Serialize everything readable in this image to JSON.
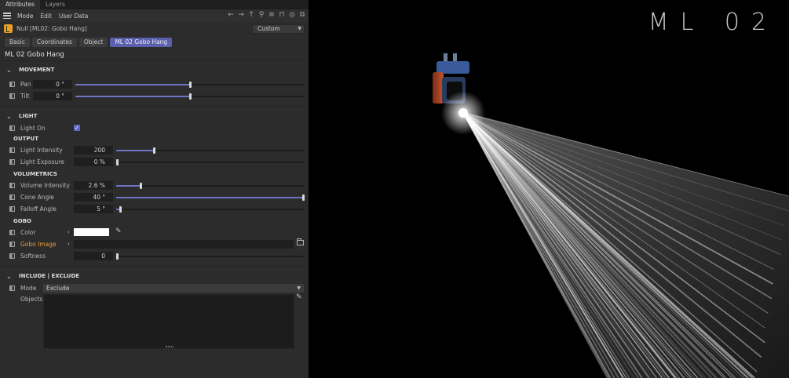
{
  "tabs": [
    "Attributes",
    "Layers"
  ],
  "menu": [
    "Mode",
    "Edit",
    "User Data"
  ],
  "toolbar_icons": [
    "back-icon",
    "forward-icon",
    "up-icon",
    "search-icon",
    "filter-icon",
    "lock-icon",
    "target-icon",
    "new-window-icon"
  ],
  "object": {
    "name": "Null [ML02: Gobo Hang]",
    "icon": "null-object-icon",
    "preset": "Custom"
  },
  "page_tabs": [
    {
      "label": "Basic",
      "active": false
    },
    {
      "label": "Coordinates",
      "active": false
    },
    {
      "label": "Object",
      "active": false
    },
    {
      "label": "ML 02 Gobo Hang",
      "active": true
    }
  ],
  "panel_title": "ML 02 Gobo Hang",
  "movement": {
    "header": "MOVEMENT",
    "pan": {
      "label": "Pan",
      "value": "0 °",
      "level": 0.5
    },
    "tilt": {
      "label": "Tilt",
      "value": "0 °",
      "level": 0.5
    }
  },
  "light": {
    "header": "LIGHT",
    "light_on": {
      "label": "Light On",
      "checked": true
    },
    "output_header": "OUTPUT",
    "intensity": {
      "label": "Light Intensity",
      "value": "200",
      "level": 0.2
    },
    "exposure": {
      "label": "Light Exposure",
      "value": "0 %",
      "level": 0.0
    },
    "volumetrics_header": "VOLUMETRICS",
    "volume_intensity": {
      "label": "Volume Intensity",
      "value": "2.6 %",
      "level": 0.13
    },
    "cone_angle": {
      "label": "Cone Angle",
      "value": "40 °",
      "level": 1.0
    },
    "falloff_angle": {
      "label": "Falloff Angle",
      "value": "5 °",
      "level": 0.02
    },
    "gobo_header": "GOBO",
    "color": {
      "label": "Color",
      "value": "#ffffff"
    },
    "gobo_image": {
      "label": "Gobo Image",
      "value": ""
    },
    "softness": {
      "label": "Softness",
      "value": "0",
      "level": 0.0
    }
  },
  "include_exclude": {
    "header": "INCLUDE | EXCLUDE",
    "mode": {
      "label": "Mode",
      "value": "Exclude"
    },
    "objects": {
      "label": "Objects"
    }
  },
  "viewport": {
    "title": "ML 02",
    "colors": {
      "beam": "#ffffff",
      "background": "#000000",
      "fixture_accent": "#c4542a",
      "fixture_blue": "#3a5a9a"
    }
  },
  "colors": {
    "accent": "#6e73c6",
    "panel_bg": "#2c2c2c",
    "highlight_label": "#e89a3c"
  }
}
